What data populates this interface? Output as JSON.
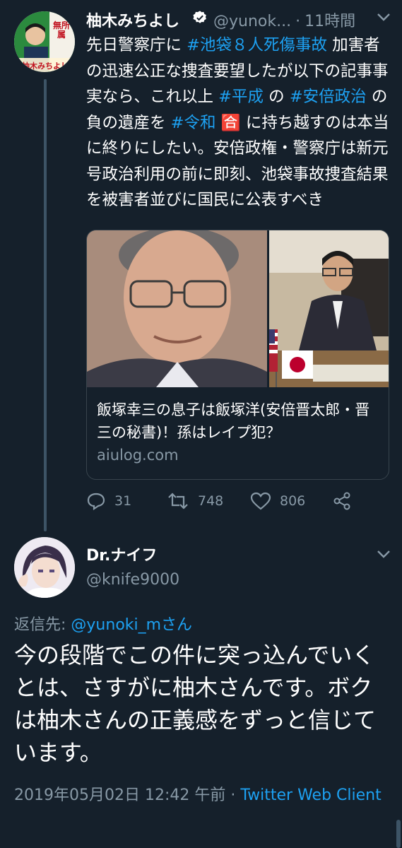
{
  "tweet1": {
    "author_name": "柚木みちよし",
    "handle": "@yunok...",
    "time_sep": "·",
    "time": "11時間",
    "text_parts": [
      {
        "t": "先日警察庁に ",
        "link": false
      },
      {
        "t": "#池袋８人死傷事故",
        "link": true
      },
      {
        "t": " 加害者の迅速公正な捜査要望したが以下の記事事実なら、これ以上 ",
        "link": false
      },
      {
        "t": "#平成",
        "link": true
      },
      {
        "t": " の ",
        "link": false
      },
      {
        "t": "#安倍政治",
        "link": true
      },
      {
        "t": " の負の遺産を ",
        "link": false
      },
      {
        "t": "#令和",
        "link": true
      },
      {
        "t": " 🈴 に持ち越すのは本当に終りにしたい。安倍政権・警察庁は新元号政治利用の前に即刻、池袋事故捜査結果を被害者並びに国民に公表すべき",
        "link": false
      }
    ],
    "avatar_text": [
      "無所属",
      "柚木みちよし"
    ],
    "card": {
      "title": "飯塚幸三の息子は飯塚洋(安倍晋太郎・晋三の秘書)！孫はレイプ犯？",
      "domain": "aiulog.com"
    },
    "actions": {
      "replies": "31",
      "retweets": "748",
      "likes": "806"
    }
  },
  "tweet2": {
    "author_name": "Dr.ナイフ",
    "handle": "@knife9000",
    "replying_prefix": "返信先: ",
    "replying_to": "@yunoki_mさん",
    "text": "今の段階でこの件に突っ込んでいくとは、さすがに柚木さんです。ボクは柚木さんの正義感をずっと信じています。",
    "timestamp": "2019年05月02日 12:42 午前",
    "meta_sep": " · ",
    "source": "Twitter Web Client"
  },
  "icons": {
    "verified": "verified-badge-icon",
    "caret": "chevron-down-icon",
    "reply": "reply-icon",
    "retweet": "retweet-icon",
    "like": "heart-icon",
    "share": "share-icon"
  },
  "colors": {
    "background": "#15202b",
    "link": "#1da1f2",
    "muted": "#8899a6",
    "border": "#38444d"
  }
}
